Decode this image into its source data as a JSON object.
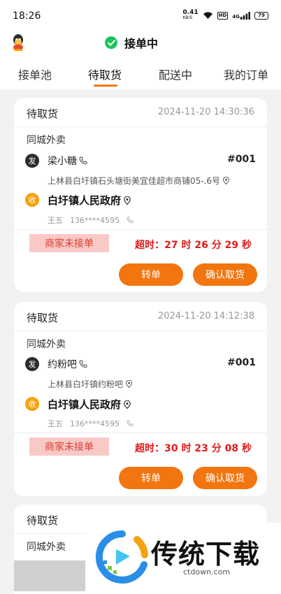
{
  "status_bar": {
    "time": "18:26",
    "speed": "0.41",
    "speed_unit": "KB/S",
    "hd": "HD",
    "net": "4G",
    "battery": "79"
  },
  "header": {
    "title": "接单中"
  },
  "tabs": [
    {
      "label": "接单池"
    },
    {
      "label": "待取货"
    },
    {
      "label": "配送中"
    },
    {
      "label": "我的订单"
    }
  ],
  "orders": [
    {
      "status": "待取货",
      "time": "2024-11-20 14:30:36",
      "type": "同城外卖",
      "send_badge": "发",
      "shop": "梁小糖",
      "order_no": "#001",
      "shop_address": "上林县白圩镇石头塘街美宜佳超市商铺05-.6号",
      "recv_badge": "收",
      "receiver": "白圩镇人民政府",
      "contact_name": "王五",
      "contact_phone": "136****4595",
      "merchant_status": "商家未接单",
      "timeout": "超时：27 时 26 分 29 秒",
      "transfer_label": "转单",
      "confirm_label": "确认取货"
    },
    {
      "status": "待取货",
      "time": "2024-11-20 14:12:38",
      "type": "同城外卖",
      "send_badge": "发",
      "shop": "约粉吧",
      "order_no": "#001",
      "shop_address": "上林县白圩镇约粉吧",
      "recv_badge": "收",
      "receiver": "白圩镇人民政府",
      "contact_name": "王五",
      "contact_phone": "136****4595",
      "merchant_status": "商家未接单",
      "timeout": "超时：30 时 23 分 08 秒",
      "transfer_label": "转单",
      "confirm_label": "确认取货"
    },
    {
      "status": "待取货",
      "type": "同城外卖"
    }
  ],
  "watermark": {
    "brand": "传统下载",
    "url": "ctdown.com"
  },
  "colors": {
    "accent": "#f27510",
    "alert": "#e01a1a",
    "success": "#1fc35c"
  }
}
